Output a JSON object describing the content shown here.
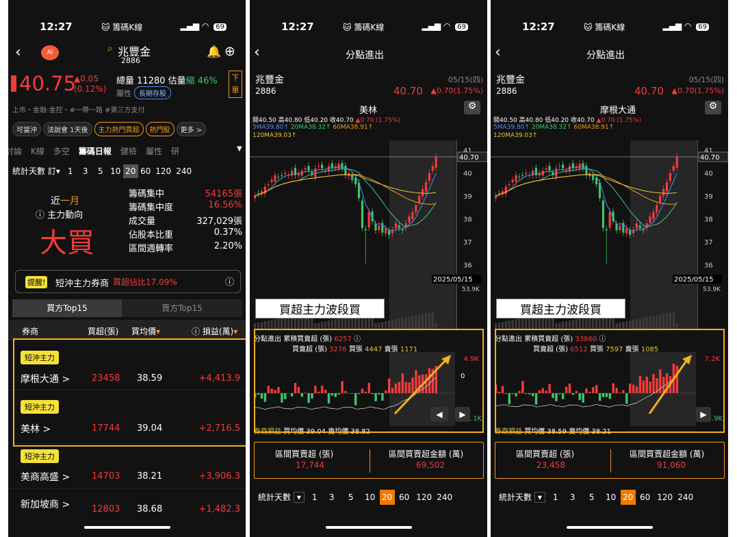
{
  "status": {
    "time": "12:27",
    "app": "🐱 籌碼K線",
    "battery": "69"
  },
  "p1": {
    "search": "兆豐金",
    "code": "2886",
    "price": "40.75",
    "chg": "▲0.05",
    "pct": "(0.12%)",
    "vol_label": "總量",
    "vol": "11280",
    "est": "估量",
    "shrink": "縮 46%",
    "attr": "屬性",
    "attr_tag": "長期存股",
    "side_btn": "下單",
    "tags": "上市・金融-金控・#一帶一路 #第三方支付",
    "chips": [
      "可當沖",
      "法說會 1天後",
      "主力熱門買超",
      "熱門股",
      "更多 >"
    ],
    "tabs": [
      "討論",
      "K線",
      "多空",
      "籌碼日報",
      "健檢",
      "屬性",
      "研"
    ],
    "days_label": "統計天數",
    "days_prefix": "訂",
    "days": [
      "1",
      "3",
      "5",
      "10",
      "20",
      "60",
      "120",
      "240"
    ],
    "period": "近",
    "period_hl": "一月",
    "dir_label": "主力動向",
    "dir": "大買",
    "stats": [
      [
        "籌碼集中",
        "54165張"
      ],
      [
        "籌碼集中度",
        "16.56%"
      ],
      [
        "成交量",
        "327,029張"
      ],
      [
        "佔股本比重",
        "0.37%"
      ],
      [
        "區間週轉率",
        "2.20%"
      ]
    ],
    "alert_tag": "提醒!",
    "alert": "短沖主力券商",
    "alert_red": "買超佔比17.09%",
    "top_buy": "買方Top15",
    "top_sell": "賣方Top15",
    "cols": [
      "券商",
      "買超(張)",
      "買均價",
      "ⓘ 損益(萬)"
    ],
    "brokers": [
      {
        "tag": "短沖主力",
        "name": "摩根大通 >",
        "buy": "23458",
        "avg": "38.59",
        "pl": "+4,413.9"
      },
      {
        "tag": "短沖主力",
        "name": "美林 >",
        "buy": "17744",
        "avg": "39.04",
        "pl": "+2,716.5"
      },
      {
        "tag": "短沖主力",
        "name": "美商高盛 >",
        "buy": "14703",
        "avg": "38.21",
        "pl": "+3,906.3"
      },
      {
        "tag": "",
        "name": "新加坡商 >",
        "buy": "12803",
        "avg": "38.68",
        "pl": "+1,482.3"
      }
    ]
  },
  "chart_common": {
    "title": "分點進出",
    "stock": "兆豐金",
    "code": "2886",
    "date": "05/15(四)",
    "price": "40.70",
    "chg": "▲0.70(1.75%)",
    "ohlc": "開40.50 高40.80 低40.20 收40.70",
    "ohlc_chg": "▲0.70 (1.75%)",
    "ma5": "5MA39.80↑",
    "ma20": "20MA38.32↑",
    "ma60": "60MA38.91↑",
    "ma120": "120MA39.03↑",
    "price_ticks": [
      "41",
      "40",
      "39",
      "38",
      "37",
      "36"
    ],
    "cur_price": "40.70",
    "cursor_date": "2025/05/15",
    "vol_max": "53.9K",
    "label": "買超主力波段買",
    "days_label": "統計天數",
    "days": [
      "1",
      "3",
      "5",
      "10",
      "20",
      "60",
      "120",
      "240"
    ],
    "sum_l": "區間買賣超 (張)",
    "sum_r": "區間買賣超金額 (萬)",
    "cum_label": "累積買賣超 (張)",
    "bs_label": "買賣超 (張)",
    "buy_label": "買張",
    "sell_label": "賣張",
    "pl_label": "券商損益",
    "bavg": "買均價",
    "savg": "賣均價"
  },
  "p2": {
    "broker": "美林",
    "cum": "6257",
    "bs": "3276",
    "buy": "4447",
    "sell": "1171",
    "top": "4.9K",
    "bottom": "2.1K",
    "zero": "0",
    "bavg": "39.04",
    "savg": "38.82",
    "sum1": "17,744",
    "sum2": "69,502"
  },
  "p3": {
    "broker": "摩根大通",
    "cum": "33860",
    "bs": "6512",
    "buy": "7597",
    "sell": "1085",
    "top": "7.2K",
    "bottom": "2.9K",
    "bavg": "38.59",
    "savg": "38.21",
    "sum1": "23,458",
    "sum2": "91,060"
  }
}
